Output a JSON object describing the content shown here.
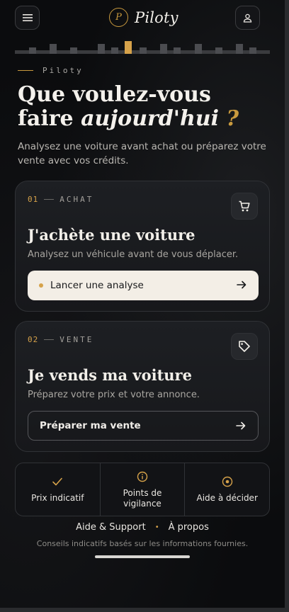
{
  "brand": {
    "logo_letter": "P",
    "name": "Piloty"
  },
  "header": {
    "menu_icon": "menu-icon",
    "profile_icon": "user-icon"
  },
  "eyebrow": "Piloty",
  "headline": {
    "line1": "Que voulez-vous",
    "line2_plain": "faire ",
    "line2_italic": "aujourd'hui",
    "line2_mark": " ?"
  },
  "subtitle": "Analysez une voiture avant achat ou préparez votre vente avec vos crédits.",
  "cards": [
    {
      "number": "01",
      "category": "ACHAT",
      "icon": "cart-icon",
      "title": "J'achète une voiture",
      "description": "Analysez un véhicule avant de vous déplacer.",
      "button_label": "Lancer une analyse"
    },
    {
      "number": "02",
      "category": "VENTE",
      "icon": "tag-icon",
      "title": "Je vends ma voiture",
      "description": "Préparez votre prix et votre annonce.",
      "button_label": "Préparer ma vente"
    }
  ],
  "features": [
    {
      "icon": "check-icon",
      "label": "Prix indicatif"
    },
    {
      "icon": "info-icon",
      "label": "Points de vigilance"
    },
    {
      "icon": "target-icon",
      "label": "Aide à décider"
    }
  ],
  "footer": {
    "support_link": "Aide & Support",
    "separator": "•",
    "about_link": "À propos",
    "disclaimer": "Conseils indicatifs basés sur les informations fournies."
  },
  "colors": {
    "accent": "#d6a24a",
    "background": "#0b0c0e",
    "card": "#1b1d21",
    "primary_button": "#f3eee6"
  }
}
